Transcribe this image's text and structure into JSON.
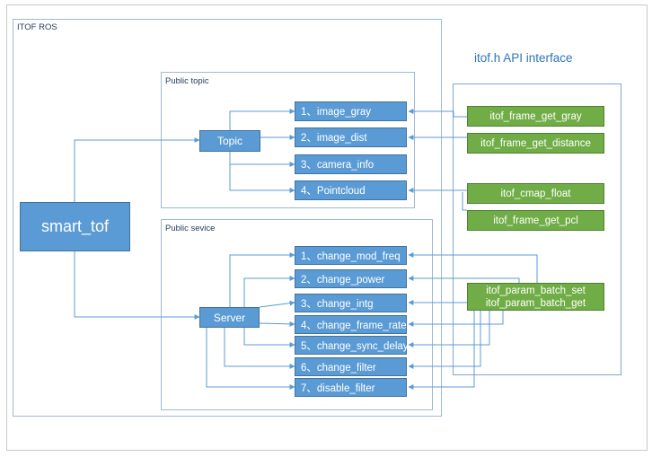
{
  "itof_ros": {
    "title": "ITOF ROS"
  },
  "smart_tof": {
    "label": "smart_tof"
  },
  "public_topic": {
    "title": "Public topic",
    "hub": "Topic",
    "items": [
      "1、image_gray",
      "2、image_dist",
      "3、camera_info",
      "4、Pointcloud"
    ]
  },
  "public_service": {
    "title": "Public sevice",
    "hub": "Server",
    "items": [
      "1、change_mod_freq",
      "2、change_power",
      "3、change_intg",
      "4、change_frame_rate",
      "5、change_sync_delay",
      "6、change_filter",
      "7、disable_filter"
    ]
  },
  "api": {
    "title": "itof.h API interface",
    "functions": [
      "itof_frame_get_gray",
      "itof_frame_get_distance",
      "itof_cmap_float",
      "itof_frame_get_pcl"
    ],
    "batch": [
      "itof_param_batch_set",
      "itof_param_batch_get"
    ]
  },
  "colors": {
    "blue_box": "#5b9bd5",
    "green_box": "#70ad47",
    "frame": "#9fb8d6",
    "connector": "#5b9bd5"
  }
}
